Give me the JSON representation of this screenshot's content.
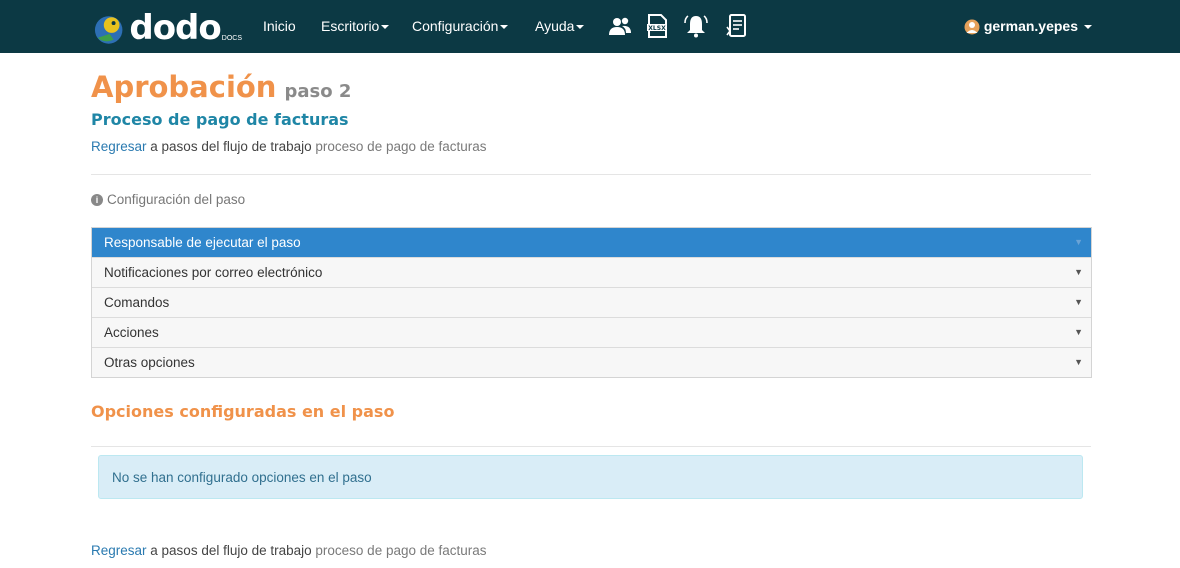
{
  "nav": {
    "logo_text": "dodo",
    "logo_sub": "DOCS",
    "items": [
      {
        "label": "Inicio",
        "dropdown": false
      },
      {
        "label": "Escritorio",
        "dropdown": true
      },
      {
        "label": "Configuración",
        "dropdown": true
      },
      {
        "label": "Ayuda",
        "dropdown": true
      }
    ],
    "icons": [
      "users-icon",
      "xlsx-file-icon",
      "bell-icon",
      "document-list-icon"
    ],
    "user": "german.yepes"
  },
  "page": {
    "title": "Aprobación",
    "step": "paso 2",
    "process": "Proceso de pago de facturas",
    "breadcrumb": {
      "back_link": "Regresar",
      "middle": " a pasos del flujo de trabajo ",
      "process": "proceso de pago de facturas"
    },
    "config_label": "Configuración del paso",
    "accordion": [
      {
        "label": "Responsable de ejecutar el paso",
        "active": true
      },
      {
        "label": "Notificaciones por correo electrónico",
        "active": false
      },
      {
        "label": "Comandos",
        "active": false
      },
      {
        "label": "Acciones",
        "active": false
      },
      {
        "label": "Otras opciones",
        "active": false
      }
    ],
    "options_title": "Opciones configuradas en el paso",
    "empty_message": "No se han configurado opciones en el paso"
  },
  "colors": {
    "navbar": "#0c3944",
    "orange": "#f0924a",
    "teal": "#1f86a6",
    "active_blue": "#2f86cc",
    "alert_bg": "#d9edf7"
  }
}
